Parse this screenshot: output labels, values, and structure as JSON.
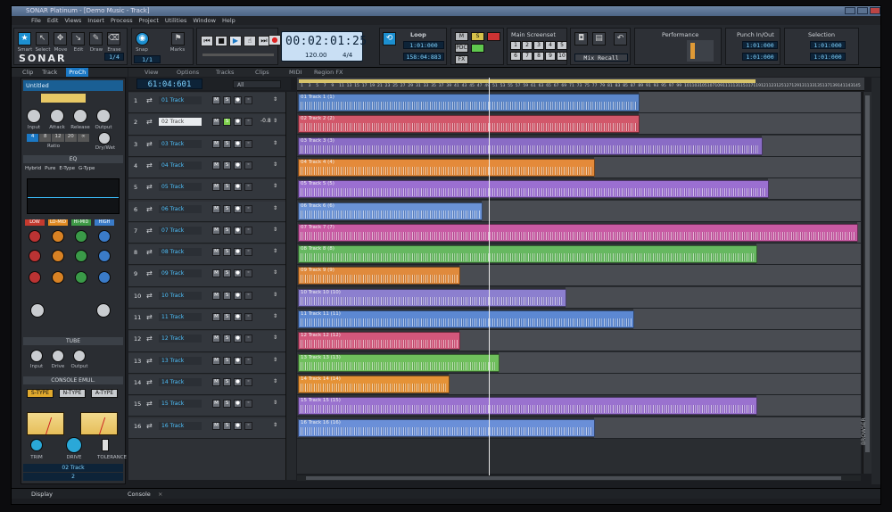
{
  "window": {
    "title": "SONAR Platinum - [Demo Music - Track]"
  },
  "menu": [
    "File",
    "Edit",
    "Views",
    "Insert",
    "Process",
    "Project",
    "Utilities",
    "Window",
    "Help"
  ],
  "tools": {
    "labels": [
      "Smart",
      "Select",
      "Move",
      "Edit",
      "Draw",
      "Erase"
    ],
    "snap_label": "Snap",
    "snap_value": "1/4",
    "snap_res": "1/1",
    "marks_label": "Marks",
    "brand": "SONAR"
  },
  "transport": {
    "time": "00:02:01:25",
    "tempo": "120.00",
    "meter": "4/4",
    "loop_label": "Loop",
    "loop_start": "1:01:000",
    "loop_end": "158:04:883",
    "m_label": "M",
    "s_label": "S",
    "pdc_label": "PDC",
    "fx_label": "FX",
    "screenset_label": "Main Screenset",
    "screenset_nums": [
      "1",
      "2",
      "3",
      "4",
      "5",
      "6",
      "7",
      "8",
      "9",
      "10"
    ],
    "mix_recall": "Mix Recall",
    "performance_label": "Performance",
    "punch_label": "Punch In/Out",
    "punch_in": "1:01:000",
    "punch_out": "1:01:000",
    "selection_label": "Selection",
    "sel_start": "1:01:000",
    "sel_end": "1:01:000"
  },
  "browser_tabs": [
    "Clip",
    "Track",
    "ProCh"
  ],
  "prochannel": {
    "preset": "Untitled",
    "comp_knobs": [
      "Input",
      "Attack",
      "Release",
      "Output"
    ],
    "ratio_label": "Ratio",
    "ratio_values": [
      "4",
      "8",
      "12",
      "20",
      "∞"
    ],
    "drywet_label": "Dry/Wet",
    "eq_label": "EQ",
    "eq_modes": [
      "Hybrid",
      "Pure",
      "E-Type",
      "G-Type"
    ],
    "eq_bands": [
      "LOW",
      "LO-MID",
      "HI-MID",
      "HIGH"
    ],
    "tube_label": "TUBE",
    "tube_knobs": [
      "Input",
      "Drive",
      "Output"
    ],
    "console_label": "CONSOLE EMUL.",
    "console_types": [
      "S-TYPE",
      "N-TYPE",
      "A-TYPE"
    ],
    "console_knobs": [
      "TRIM",
      "DRIVE",
      "TOLERANCE"
    ],
    "track_name": "02 Track",
    "track_num": "2",
    "display_tab": "Display"
  },
  "view_menu": [
    "View",
    "Options",
    "Tracks",
    "Clips",
    "MIDI",
    "Region FX"
  ],
  "filter_value": "All",
  "now_time": "61:04:601",
  "ruler_ticks": [
    "1",
    "3",
    "5",
    "7",
    "9",
    "11",
    "13",
    "15",
    "17",
    "19",
    "21",
    "23",
    "25",
    "27",
    "29",
    "31",
    "33",
    "35",
    "37",
    "39",
    "41",
    "43",
    "45",
    "47",
    "49",
    "51",
    "53",
    "55",
    "57",
    "59",
    "61",
    "63",
    "65",
    "67",
    "69",
    "71",
    "73",
    "75",
    "77",
    "79",
    "81",
    "83",
    "85",
    "87",
    "89",
    "91",
    "93",
    "95",
    "97",
    "99",
    "101",
    "103",
    "105",
    "107",
    "109",
    "111",
    "113",
    "115",
    "117",
    "119",
    "121",
    "123",
    "125",
    "127",
    "129",
    "131",
    "133",
    "135",
    "137",
    "139",
    "141",
    "143",
    "145"
  ],
  "tracks": [
    {
      "num": "1",
      "name": "01 Track",
      "clip": "01 Track 1 (1)",
      "color": "#5b86c9",
      "fraction": 0.61
    },
    {
      "num": "2",
      "name": "02 Track",
      "clip": "02 Track 2 (2)",
      "color": "#d2576a",
      "fraction": 0.61,
      "selected": true,
      "volume": "-0.8"
    },
    {
      "num": "3",
      "name": "03 Track",
      "clip": "03 Track 3 (3)",
      "color": "#8a6cc6",
      "fraction": 0.83
    },
    {
      "num": "4",
      "name": "04 Track",
      "clip": "04 Track 4 (4)",
      "color": "#e48a3a",
      "fraction": 0.53
    },
    {
      "num": "5",
      "name": "05 Track",
      "clip": "05 Track 5 (5)",
      "color": "#9b6fd1",
      "fraction": 0.84
    },
    {
      "num": "6",
      "name": "06 Track",
      "clip": "06 Track 6 (6)",
      "color": "#6a92d6",
      "fraction": 0.33
    },
    {
      "num": "7",
      "name": "07 Track",
      "clip": "07 Track 7 (7)",
      "color": "#c85aa3",
      "fraction": 1.0
    },
    {
      "num": "8",
      "name": "08 Track",
      "clip": "08 Track 8 (8)",
      "color": "#66b860",
      "fraction": 0.82
    },
    {
      "num": "9",
      "name": "09 Track",
      "clip": "09 Track 9 (9)",
      "color": "#e08a3c",
      "fraction": 0.29
    },
    {
      "num": "10",
      "name": "10 Track",
      "clip": "10 Track 10 (10)",
      "color": "#8c7fcf",
      "fraction": 0.48
    },
    {
      "num": "11",
      "name": "11 Track",
      "clip": "11 Track 11 (11)",
      "color": "#5c88d2",
      "fraction": 0.6
    },
    {
      "num": "12",
      "name": "12 Track",
      "clip": "12 Track 12 (12)",
      "color": "#d2577b",
      "fraction": 0.29
    },
    {
      "num": "13",
      "name": "13 Track",
      "clip": "13 Track 13 (13)",
      "color": "#6fbf5c",
      "fraction": 0.36
    },
    {
      "num": "14",
      "name": "14 Track",
      "clip": "14 Track 14 (14)",
      "color": "#e59236",
      "fraction": 0.27
    },
    {
      "num": "15",
      "name": "15 Track",
      "clip": "15 Track 15 (15)",
      "color": "#9a72cf",
      "fraction": 0.82
    },
    {
      "num": "16",
      "name": "16 Track",
      "clip": "16 Track 16 (16)",
      "color": "#6a8fd8",
      "fraction": 0.53
    }
  ],
  "right_strip": {
    "browser_label": "BROWSER"
  },
  "bottom_tabs": [
    "Console"
  ]
}
